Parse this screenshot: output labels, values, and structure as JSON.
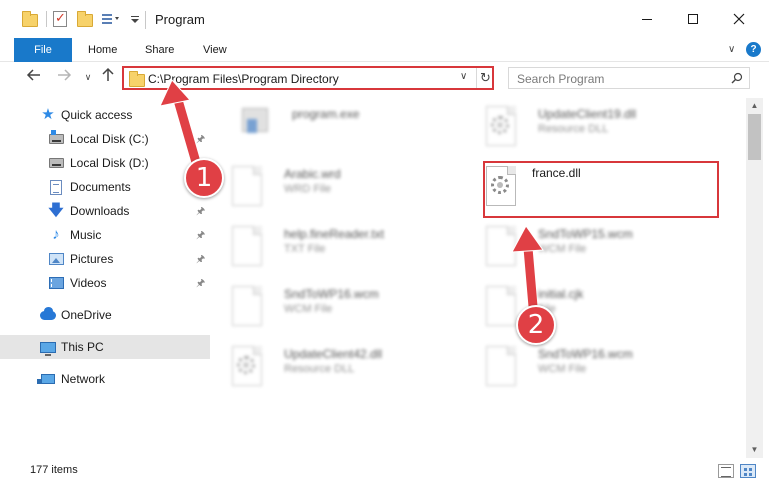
{
  "window": {
    "title": "Program"
  },
  "ribbon": {
    "tabs": [
      {
        "label": "File"
      },
      {
        "label": "Home"
      },
      {
        "label": "Share"
      },
      {
        "label": "View"
      }
    ],
    "help_label": "?"
  },
  "navigation": {
    "address": "C:\\Program Files\\Program Directory",
    "search_placeholder": "Search Program"
  },
  "sidebar": {
    "items": [
      {
        "label": "Quick access",
        "icon": "star-icon"
      },
      {
        "label": "Local Disk (C:)",
        "icon": "disk-icon"
      },
      {
        "label": "Local Disk (D:)",
        "icon": "disk-icon"
      },
      {
        "label": "Documents",
        "icon": "documents-icon"
      },
      {
        "label": "Downloads",
        "icon": "downloads-icon"
      },
      {
        "label": "Music",
        "icon": "music-icon"
      },
      {
        "label": "Pictures",
        "icon": "pictures-icon"
      },
      {
        "label": "Videos",
        "icon": "videos-icon"
      },
      {
        "label": "OneDrive",
        "icon": "onedrive-icon"
      },
      {
        "label": "This PC",
        "icon": "this-pc-icon"
      },
      {
        "label": "Network",
        "icon": "network-icon"
      }
    ]
  },
  "files": [
    {
      "name": "program.exe",
      "type": ""
    },
    {
      "name": "UpdateClient19.dll",
      "type": "Resource DLL"
    },
    {
      "name": "Arabic.wrd",
      "type": "WRD File"
    },
    {
      "name": "france.dll",
      "type": ""
    },
    {
      "name": "help.fineReader.txt",
      "type": "TXT File"
    },
    {
      "name": "SndToWP15.wcm",
      "type": "WCM File"
    },
    {
      "name": "SndToWP16.wcm",
      "type": "WCM File"
    },
    {
      "name": "initial.cjk",
      "type": "File"
    },
    {
      "name": "UpdateClient42.dll",
      "type": "Resource DLL"
    },
    {
      "name": "SndToWP16.wcm",
      "type": "WCM File"
    }
  ],
  "status": {
    "item_count": "177 items"
  },
  "annotations": {
    "step1": "1",
    "step2": "2",
    "color": "#e04045"
  },
  "colors": {
    "accent": "#1979ca",
    "highlight": "#d8373b"
  }
}
